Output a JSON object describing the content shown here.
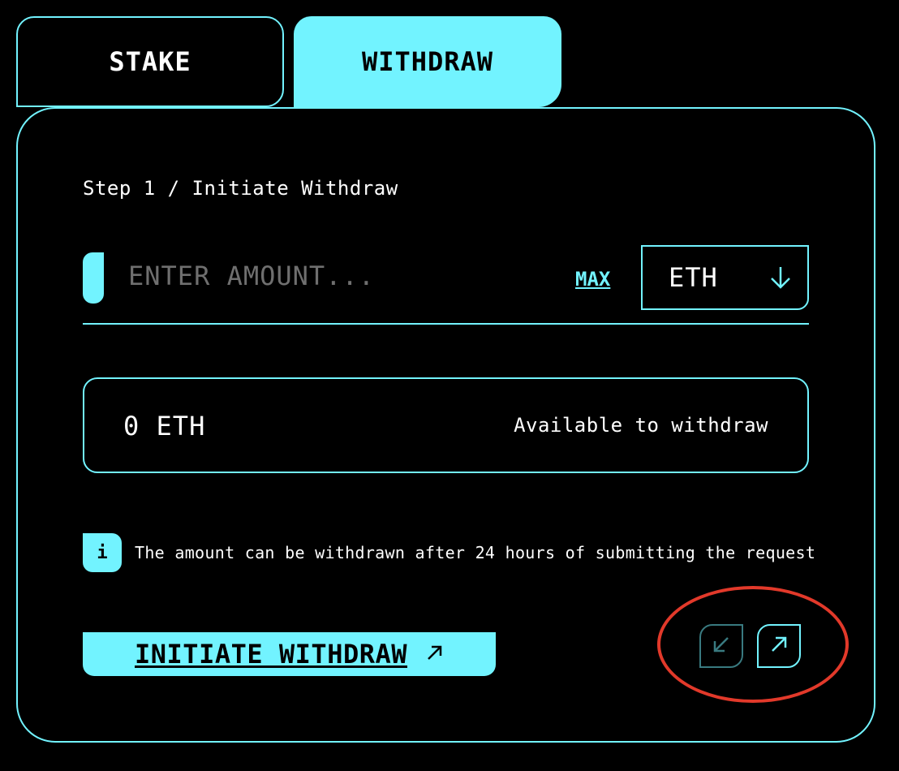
{
  "tabs": {
    "stake_label": "STAKE",
    "withdraw_label": "WITHDRAW",
    "active": "WITHDRAW"
  },
  "form": {
    "step_label": "Step 1 / Initiate Withdraw",
    "amount_placeholder": "ENTER AMOUNT...",
    "amount_value": "",
    "max_label": "MAX",
    "token_selected": "ETH",
    "token_icon": "arrow-down-icon"
  },
  "available": {
    "value": "0 ETH",
    "label": "Available to withdraw"
  },
  "info": {
    "badge": "i",
    "text": "The amount can be withdrawn after 24 hours of submitting the request"
  },
  "action": {
    "initiate_label": "INITIATE WITHDRAW",
    "initiate_icon": "arrow-up-right-icon"
  },
  "navigation": {
    "prev_icon": "arrow-down-left-icon",
    "next_icon": "arrow-up-right-icon",
    "prev_enabled": false,
    "next_enabled": true
  },
  "colors": {
    "accent": "#72f3ff",
    "background": "#000000",
    "annotation": "#e2392a"
  }
}
